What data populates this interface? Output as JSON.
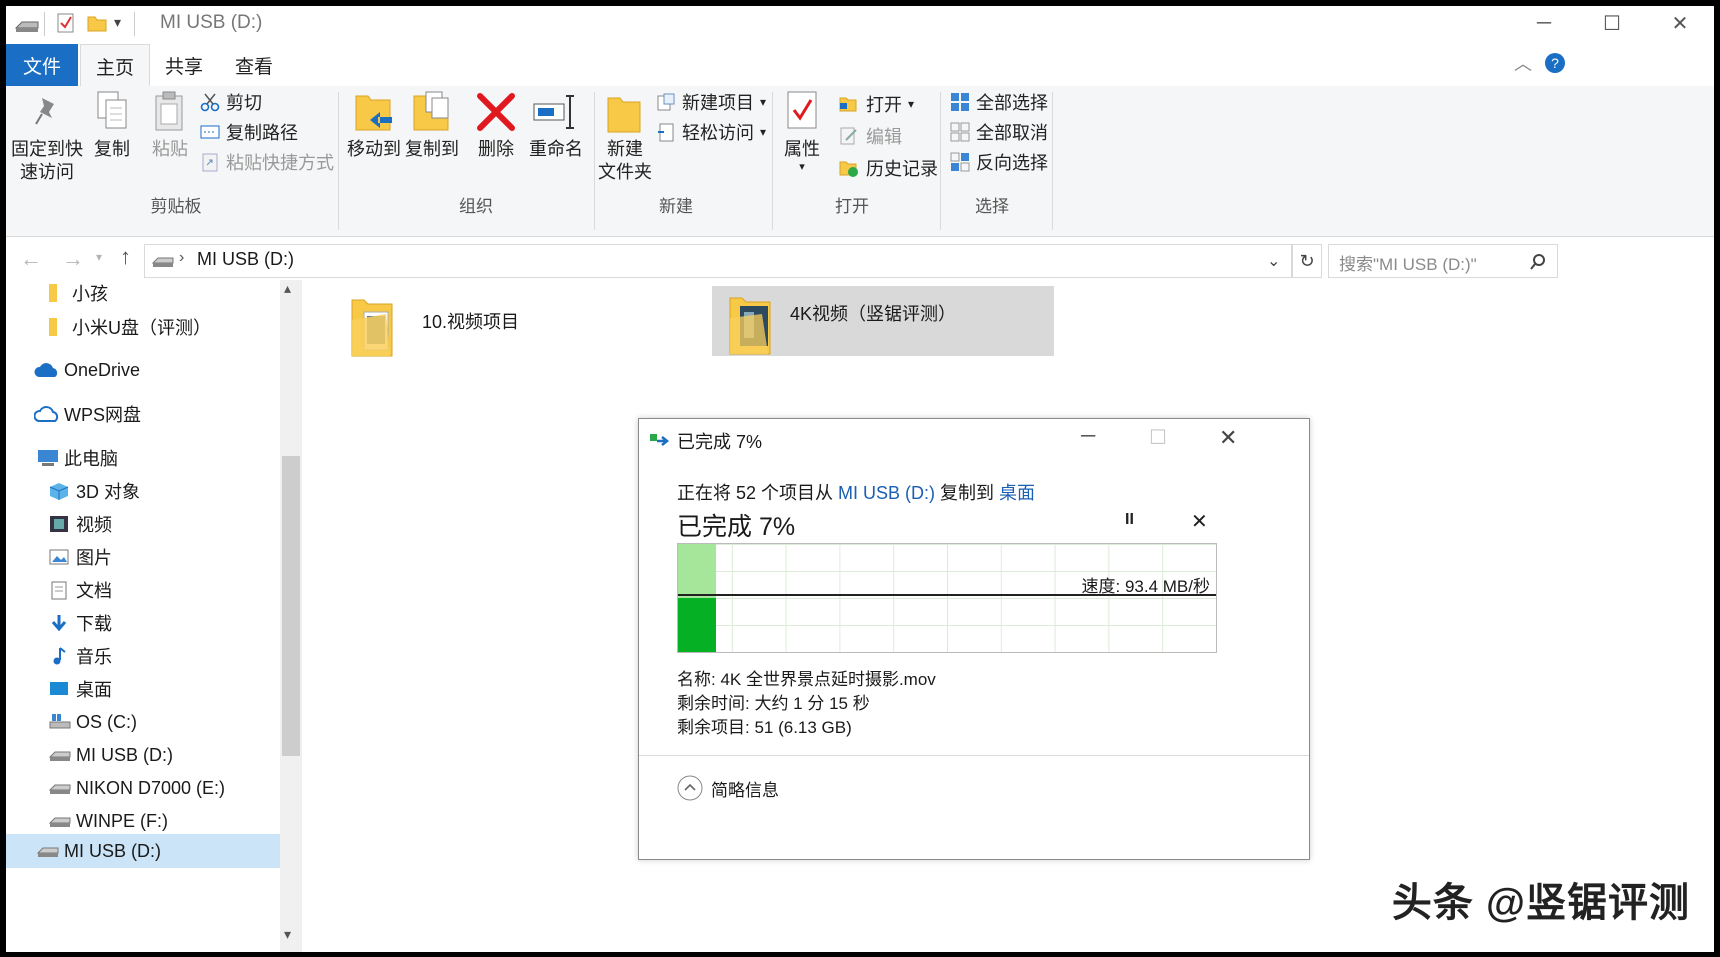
{
  "window": {
    "title": "MI USB (D:)",
    "controls": {
      "minimize": "─",
      "maximize": "☐",
      "close": "✕"
    }
  },
  "tabs": [
    {
      "label": "文件"
    },
    {
      "label": "主页"
    },
    {
      "label": "共享"
    },
    {
      "label": "查看"
    }
  ],
  "ribbon": {
    "pin_label_1": "固定到快",
    "pin_label_2": "速访问",
    "copy": "复制",
    "paste": "粘贴",
    "cut": "剪切",
    "copy_path": "复制路径",
    "paste_shortcut": "粘贴快捷方式",
    "clipboard_group": "剪贴板",
    "move_to": "移动到",
    "copy_to": "复制到",
    "delete": "删除",
    "rename": "重命名",
    "organize_group": "组织",
    "new_folder_1": "新建",
    "new_folder_2": "文件夹",
    "new_item": "新建项目",
    "easy_access": "轻松访问",
    "new_group": "新建",
    "properties": "属性",
    "open": "打开",
    "edit": "编辑",
    "history": "历史记录",
    "open_group": "打开",
    "select_all": "全部选择",
    "select_none": "全部取消",
    "invert_selection": "反向选择",
    "select_group": "选择"
  },
  "address": {
    "path": "MI USB (D:)",
    "search_placeholder": "搜索\"MI USB (D:)\""
  },
  "sidebar": {
    "items": [
      {
        "label": "小孩"
      },
      {
        "label": "小米U盘（评测）"
      },
      {
        "label": "OneDrive"
      },
      {
        "label": "WPS网盘"
      },
      {
        "label": "此电脑"
      },
      {
        "label": "3D 对象"
      },
      {
        "label": "视频"
      },
      {
        "label": "图片"
      },
      {
        "label": "文档"
      },
      {
        "label": "下载"
      },
      {
        "label": "音乐"
      },
      {
        "label": "桌面"
      },
      {
        "label": "OS (C:)"
      },
      {
        "label": "MI USB (D:)"
      },
      {
        "label": "NIKON D7000 (E:)"
      },
      {
        "label": "WINPE (F:)"
      },
      {
        "label": "MI USB (D:)"
      }
    ]
  },
  "files": [
    {
      "name": "10.视频项目"
    },
    {
      "name": "4K视频（竖锯评测）"
    }
  ],
  "dialog": {
    "title": "已完成 7%",
    "line_prefix": "正在将 52 个项目从 ",
    "source": "MI USB (D:)",
    "line_mid": " 复制到 ",
    "dest": "桌面",
    "heading": "已完成 7%",
    "pause": "II",
    "cancel": "✕",
    "progress_fraction": 0.07,
    "speed": "速度: 93.4 MB/秒",
    "name": "名称: 4K 全世界景点延时摄影.mov",
    "time_left": "剩余时间: 大约 1 分 15 秒",
    "items_left": "剩余项目: 51 (6.13 GB)",
    "less_details": "简略信息"
  },
  "watermark": "头条 @竖锯评测",
  "colors": {
    "accent": "#1a6fc4",
    "progress": "#06b025",
    "progress_light": "#a5e69a",
    "selected": "#d9d9d9",
    "link": "#1a5fb4"
  }
}
